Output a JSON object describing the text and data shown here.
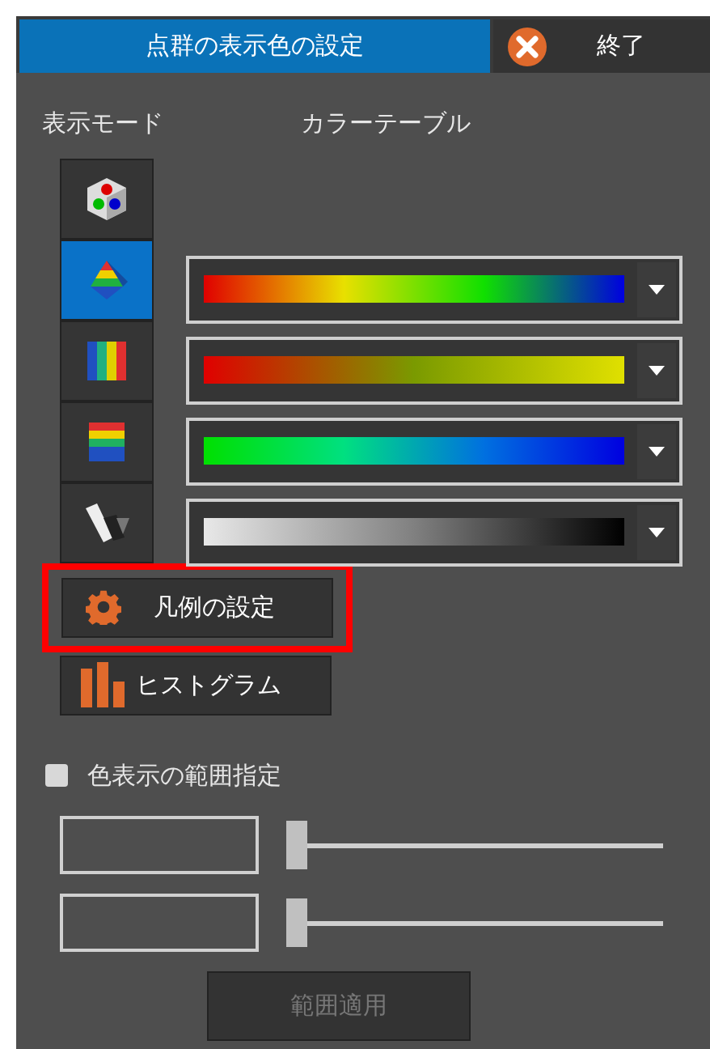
{
  "header": {
    "title": "点群の表示色の設定",
    "close_label": "終了"
  },
  "labels": {
    "mode": "表示モード",
    "color_table": "カラーテーブル"
  },
  "modes": [
    {
      "kind": "rgb",
      "selected": false
    },
    {
      "kind": "height",
      "selected": true
    },
    {
      "kind": "vertical-stripes",
      "selected": false
    },
    {
      "kind": "horizontal-stripes",
      "selected": false
    },
    {
      "kind": "intensity",
      "selected": false
    }
  ],
  "color_tables": [
    {
      "kind": "rainbow"
    },
    {
      "kind": "red-yellow"
    },
    {
      "kind": "green-blue"
    },
    {
      "kind": "grayscale"
    }
  ],
  "legend_button": {
    "label": "凡例の設定",
    "highlighted": true
  },
  "histogram_button": {
    "label": "ヒストグラム"
  },
  "range": {
    "label": "色表示の範囲指定",
    "checked": false,
    "rows": [
      {
        "level": 0
      },
      {
        "level": 0
      }
    ],
    "apply_button": {
      "label": "範囲適用",
      "disabled": true
    }
  }
}
